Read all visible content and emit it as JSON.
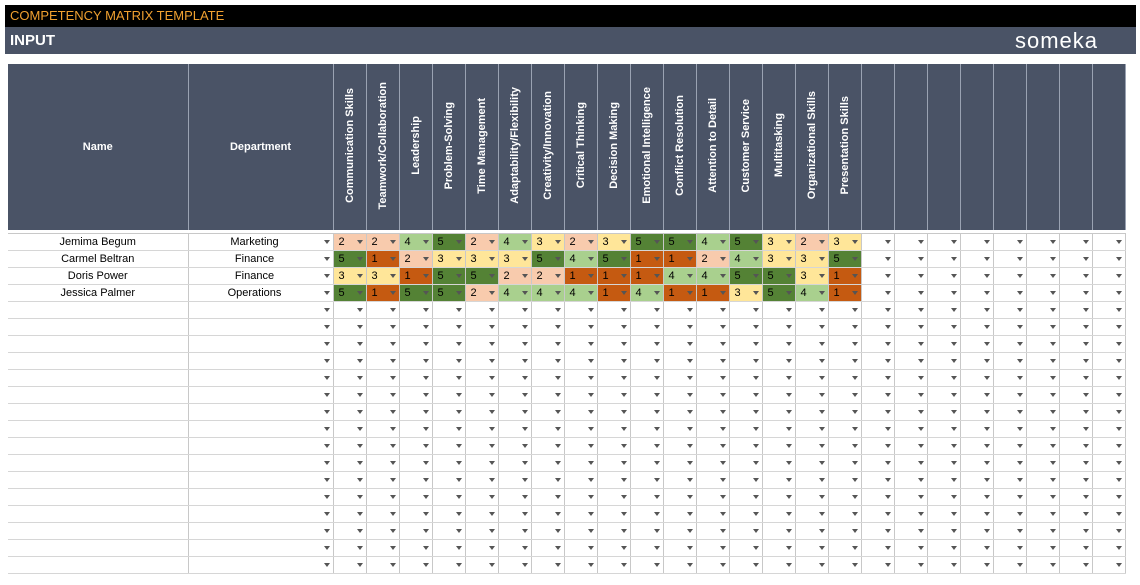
{
  "title": "COMPETENCY MATRIX TEMPLATE",
  "section": "INPUT",
  "brand": "someka",
  "columns": {
    "name": "Name",
    "department": "Department",
    "skills": [
      "Communication Skills",
      "Teamwork/Collaboration",
      "Leadership",
      "Problem-Solving",
      "Time Management",
      "Adaptability/Flexibility",
      "Creativity/Innovation",
      "Critical Thinking",
      "Decision Making",
      "Emotional Intelligence",
      "Conflict Resolution",
      "Attention to Detail",
      "Customer Service",
      "Multitasking",
      "Organizational Skills",
      "Presentation Skills"
    ],
    "extra_blank_columns": 8
  },
  "rows": [
    {
      "name": "Jemima Begum",
      "department": "Marketing",
      "scores": [
        2,
        2,
        4,
        5,
        2,
        4,
        3,
        2,
        3,
        5,
        5,
        4,
        5,
        3,
        2,
        3
      ]
    },
    {
      "name": "Carmel Beltran",
      "department": "Finance",
      "scores": [
        5,
        1,
        2,
        3,
        3,
        3,
        5,
        4,
        5,
        1,
        1,
        2,
        4,
        3,
        3,
        5
      ]
    },
    {
      "name": "Doris Power",
      "department": "Finance",
      "scores": [
        3,
        3,
        1,
        5,
        5,
        2,
        2,
        1,
        1,
        1,
        4,
        4,
        5,
        5,
        3,
        1
      ]
    },
    {
      "name": "Jessica Palmer",
      "department": "Operations",
      "scores": [
        5,
        1,
        5,
        5,
        2,
        4,
        4,
        4,
        1,
        4,
        1,
        1,
        3,
        5,
        4,
        1
      ]
    }
  ],
  "blank_rows": 16,
  "score_colors": {
    "1": "#c55a11",
    "2": "#f8cbad",
    "3": "#ffe699",
    "4": "#a9d08e",
    "5": "#548235"
  }
}
